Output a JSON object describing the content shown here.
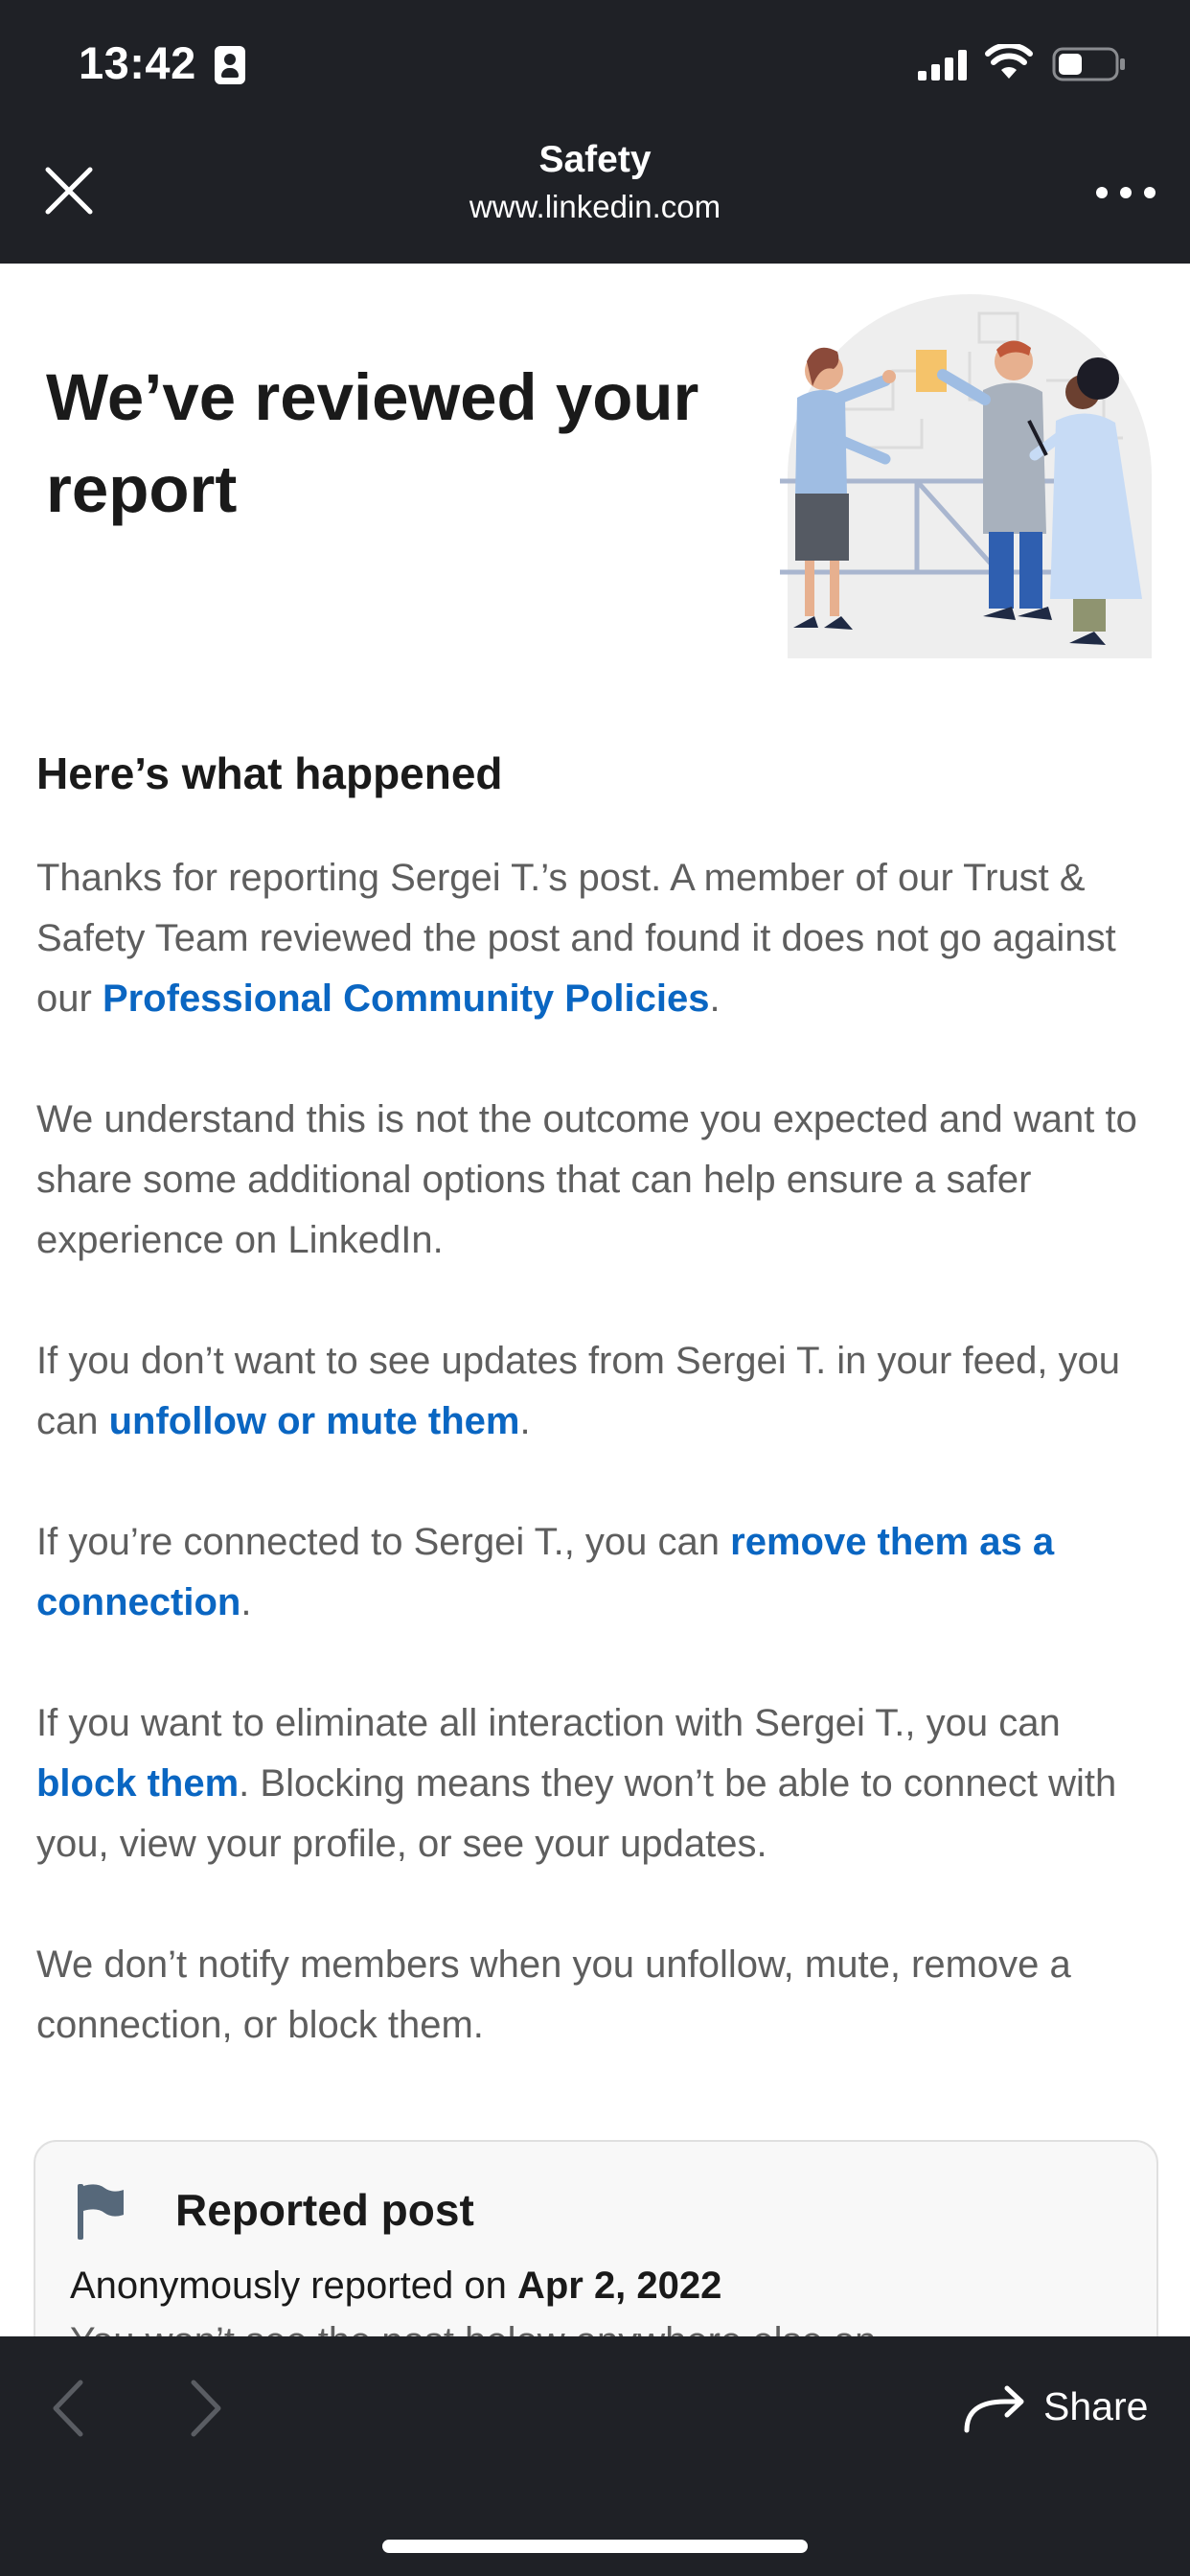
{
  "status_bar": {
    "time": "13:42"
  },
  "browser": {
    "title": "Safety",
    "url": "www.linkedin.com"
  },
  "hero": {
    "title": "We’ve reviewed your report"
  },
  "section": {
    "heading": "Here’s what happened"
  },
  "paragraphs": {
    "p1_text": "Thanks for reporting Sergei T.’s post. A member of our Trust & Safety Team reviewed the post and found it does not go against our ",
    "p1_link": "Professional Community Policies",
    "p1_end": ".",
    "p2_text": "We understand this is not the outcome you expected and want to share some additional options that can help ensure a safer experience on LinkedIn.",
    "p3_text": "If you don’t want to see updates from Sergei T. in your feed, you can ",
    "p3_link": "unfollow or mute them",
    "p3_end": ".",
    "p4_text": "If you’re connected to Sergei T., you can ",
    "p4_link": "remove them as a connection",
    "p4_end": ".",
    "p5_text": "If you want to eliminate all interaction with Sergei T., you can ",
    "p5_link": "block them",
    "p5_end": ". Blocking means they won’t be able to connect with you, view your profile, or see your updates.",
    "p6_text": "We don’t notify members when you unfollow, mute, remove a connection, or block them."
  },
  "report_card": {
    "title": "Reported post",
    "subtitle_prefix": "Anonymously reported on ",
    "date": "Apr 2, 2022",
    "partial_line": "You won’t see the post below anywhere else on"
  },
  "bottom_bar": {
    "share_label": "Share"
  },
  "colors": {
    "link": "#0a66c2",
    "chrome": "#1f2126",
    "body_text": "#5e5e5e"
  },
  "icons": [
    "close-icon",
    "more-icon",
    "flag-icon",
    "back-icon",
    "forward-icon",
    "share-icon",
    "signal-icon",
    "wifi-icon",
    "battery-icon",
    "contact-icon"
  ]
}
